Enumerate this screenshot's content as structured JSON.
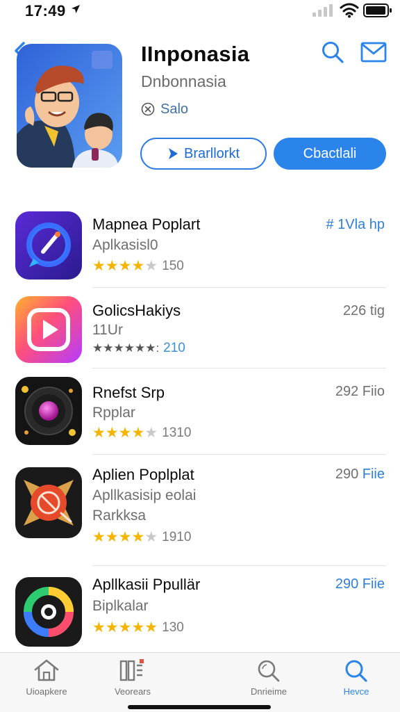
{
  "status_bar": {
    "time": "17:49",
    "location_icon": "location-arrow-icon",
    "signal_icon": "cellular-signal-icon",
    "wifi_icon": "wifi-icon",
    "battery_icon": "battery-icon"
  },
  "header": {
    "back_icon": "chevron-left-icon",
    "search_icon": "search-icon",
    "mail_icon": "mail-icon",
    "title": "IInponasia",
    "subtitle": "Dnbonnasia",
    "tag": "Salo",
    "tag_icon": "close-circle-icon",
    "primary_outline_button": "Brarllorkt",
    "primary_outline_icon": "play-icon",
    "filled_button": "Cbactlali"
  },
  "apps": [
    {
      "title": "Mapnea Poplart",
      "subtitle": "Aplkasisl0",
      "subtitle2": "",
      "stars": 4.5,
      "rating_text": "150",
      "rating_text_blue": false,
      "meta": "# 1Vla hp",
      "meta_blue": true,
      "icon": "paint-chat-icon"
    },
    {
      "title": "GolicsHakiys",
      "subtitle": "11Ur",
      "subtitle2": "",
      "stars_text": "★★★★★★:",
      "rating_text": "210",
      "rating_text_blue": true,
      "meta": "226 tig",
      "meta_blue": false,
      "icon": "play-gradient-icon"
    },
    {
      "title": "Rnefst Srp",
      "subtitle": "Rpplar",
      "subtitle2": "",
      "stars": 4,
      "rating_text": "1310",
      "rating_text_blue": false,
      "meta": "292 Fiio",
      "meta_blue": false,
      "icon": "vinyl-orb-icon"
    },
    {
      "title": "Aplien Poplplat",
      "subtitle": "Apllkasisip eolai",
      "subtitle2": "Rarkksa",
      "stars": 4.5,
      "rating_text": "1910",
      "rating_text_blue": false,
      "meta": "290 Fiie",
      "meta_blue": false,
      "meta_mixed": true,
      "icon": "compass-star-icon"
    },
    {
      "title": "Apllkasii Ppullär",
      "subtitle": "Biplkalar",
      "subtitle2": "",
      "stars": 5,
      "rating_text": "130",
      "rating_text_blue": false,
      "meta": "290 Fiie",
      "meta_blue": true,
      "icon": "color-ring-icon"
    }
  ],
  "tabs": [
    {
      "label": "Uioapkere",
      "icon": "home-icon",
      "active": false
    },
    {
      "label": "Veorears",
      "icon": "library-icon",
      "active": false
    },
    {
      "label": "Dnrieime",
      "icon": "search-icon",
      "active": false
    },
    {
      "label": "Hevce",
      "icon": "search-active-icon",
      "active": true
    }
  ],
  "colors": {
    "accent": "#2b84ea",
    "star": "#f5b400",
    "text_secondary": "#6e6e6e"
  }
}
